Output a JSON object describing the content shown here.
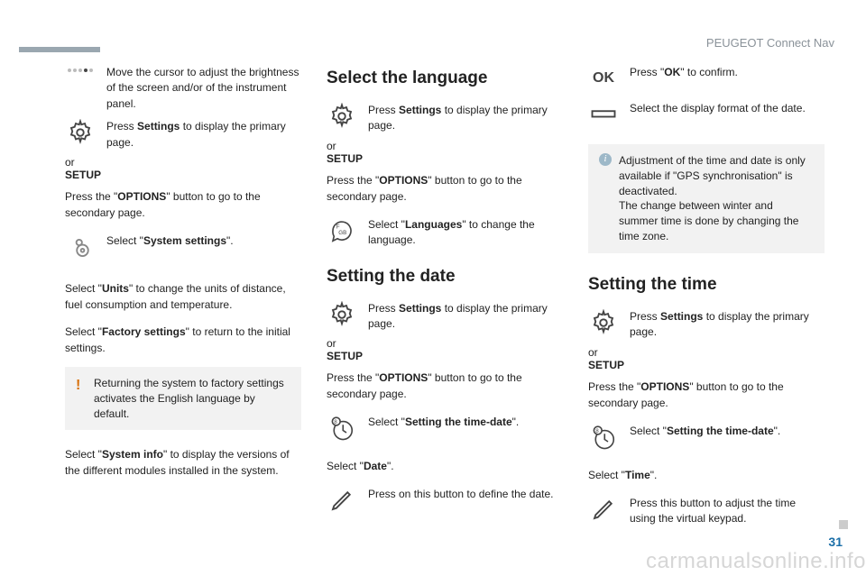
{
  "header": {
    "section": "PEUGEOT Connect Nav"
  },
  "page_number": "31",
  "watermark": "carmanualsonline.info",
  "labels": {
    "or": "or",
    "setup": "SETUP"
  },
  "col1": {
    "slider_desc": "Move the cursor to adjust the brightness of the screen and/or of the instrument panel.",
    "settings_primary_pre": "Press ",
    "settings_primary_bold": "Settings",
    "settings_primary_post": " to display the primary page.",
    "options_pre": "Press the \"",
    "options_bold": "OPTIONS",
    "options_post": "\" button to go to the secondary page.",
    "system_settings_pre": "Select \"",
    "system_settings_bold": "System settings",
    "system_settings_post": "\".",
    "units_pre": "Select \"",
    "units_bold": "Units",
    "units_post": "\" to change the units of distance, fuel consumption and temperature.",
    "factory_pre": "Select \"",
    "factory_bold": "Factory settings",
    "factory_post": "\" to return to the initial settings.",
    "warn": "Returning the system to factory settings activates the English language by default.",
    "sysinfo_pre": "Select \"",
    "sysinfo_bold": "System info",
    "sysinfo_post": "\" to display the versions of the different modules installed in the system."
  },
  "col2": {
    "h_lang": "Select the language",
    "settings_primary_pre": "Press ",
    "settings_primary_bold": "Settings",
    "settings_primary_post": " to display the primary page.",
    "options_pre": "Press the \"",
    "options_bold": "OPTIONS",
    "options_post": "\" button to go to the secondary page.",
    "lang_pre": "Select \"",
    "lang_bold": "Languages",
    "lang_post": "\" to change the language.",
    "h_date": "Setting the date",
    "date_options_pre": "Press the \"",
    "date_options_bold": "OPTIONS",
    "date_options_post": "\" button to go to the secondary page.",
    "timedate_pre": "Select \"",
    "timedate_bold": "Setting the time-date",
    "timedate_post": "\".",
    "select_date_pre": "Select \"",
    "select_date_bold": "Date",
    "select_date_post": "\".",
    "press_date": "Press on this button to define the date."
  },
  "col3": {
    "ok_label": "OK",
    "ok_pre": "Press \"",
    "ok_bold": "OK",
    "ok_post": "\" to confirm.",
    "format_text": "Select the display format of the date.",
    "info_note": "Adjustment of the time and date is only available if \"GPS synchronisation\" is deactivated.\nThe change between winter and summer time is done by changing the time zone.",
    "h_time": "Setting the time",
    "settings_primary_pre": "Press ",
    "settings_primary_bold": "Settings",
    "settings_primary_post": " to display the primary page.",
    "options_pre": "Press the \"",
    "options_bold": "OPTIONS",
    "options_post": "\" button to go to the secondary page.",
    "timedate_pre": "Select \"",
    "timedate_bold": "Setting the time-date",
    "timedate_post": "\".",
    "select_time_pre": "Select \"",
    "select_time_bold": "Time",
    "select_time_post": "\".",
    "press_time": "Press this button to adjust the time using the virtual keypad."
  }
}
